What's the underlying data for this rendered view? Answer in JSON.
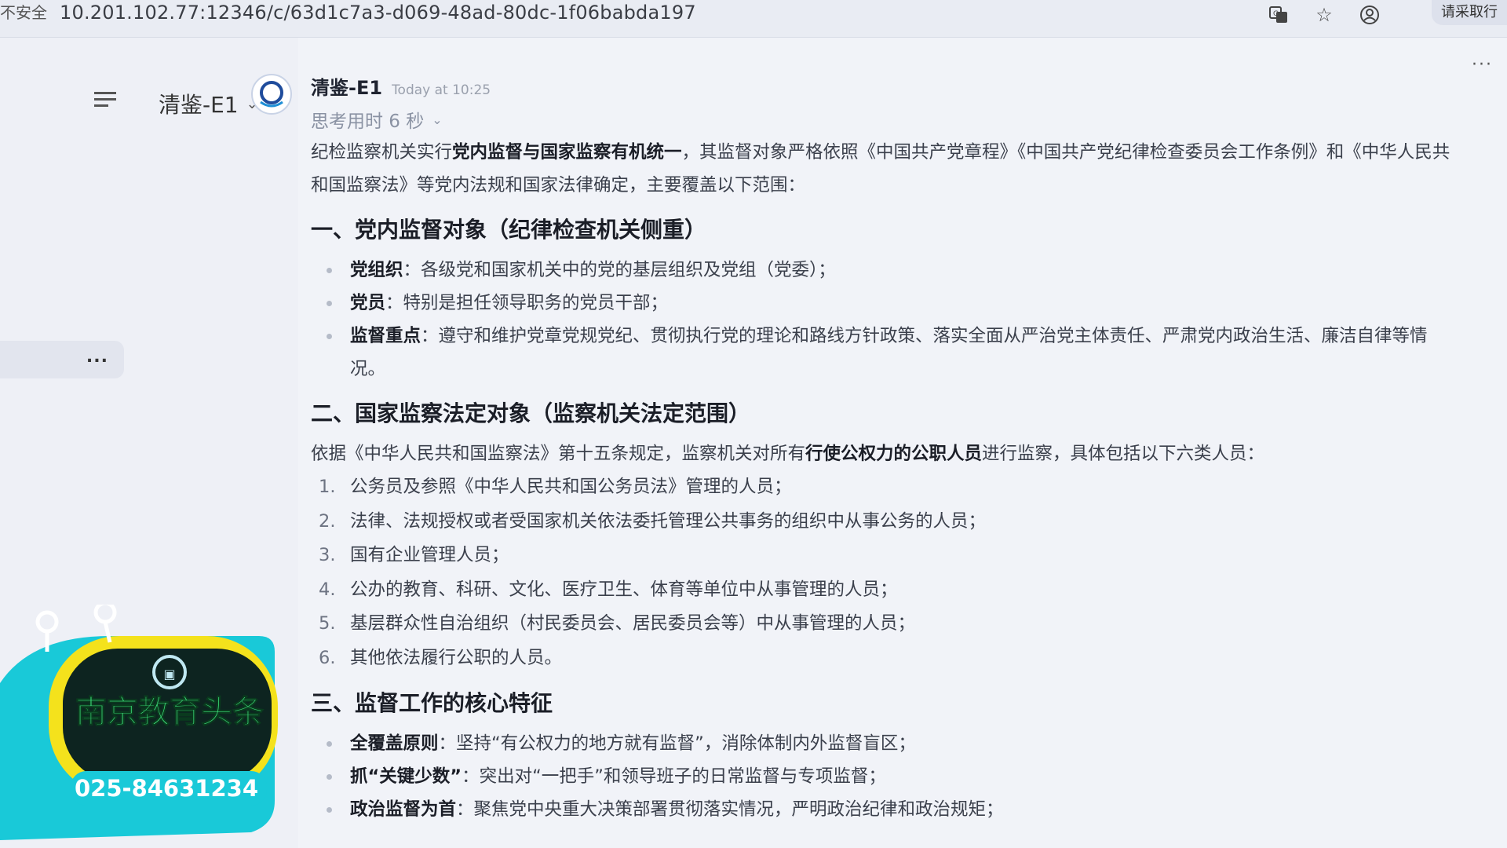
{
  "browser": {
    "insecure_label": "不安全",
    "url": "10.201.102.77:12346/c/63d1c7a3-d069-48ad-80dc-1f06babda197",
    "login_label": "请采取行"
  },
  "sidebar": {
    "model_name": "清鉴-E1",
    "item_menu_label": "..."
  },
  "chat": {
    "more_label": "···",
    "sender": "清鉴-E1",
    "time": "Today at 10:25",
    "thinking": "思考用时 6 秒",
    "intro": {
      "pre": "纪检监察机关实行",
      "bold": "党内监督与国家监察有机统一",
      "post": "，其监督对象严格依照《中国共产党章程》《中国共产党纪律检查委员会工作条例》和《中华人民共和国监察法》等党内法规和国家法律确定，主要覆盖以下范围："
    },
    "section1": {
      "title": "一、党内监督对象（纪律检查机关侧重）",
      "items": [
        {
          "bold": "党组织",
          "text": "：各级党和国家机关中的党的基层组织及党组（党委）；"
        },
        {
          "bold": "党员",
          "text": "：特别是担任领导职务的党员干部；"
        },
        {
          "bold": "监督重点",
          "text": "：遵守和维护党章党规党纪、贯彻执行党的理论和路线方针政策、落实全面从严治党主体责任、严肃党内政治生活、廉洁自律等情况。"
        }
      ]
    },
    "section2": {
      "title": "二、国家监察法定对象（监察机关法定范围）",
      "intro_pre": "依据《中华人民共和国监察法》第十五条规定，监察机关对所有",
      "intro_bold": "行使公权力的公职人员",
      "intro_post": "进行监察，具体包括以下六类人员：",
      "items": [
        {
          "n": "1.",
          "text": "公务员及参照《中华人民共和国公务员法》管理的人员；"
        },
        {
          "n": "2.",
          "text": "法律、法规授权或者受国家机关依法委托管理公共事务的组织中从事公务的人员；"
        },
        {
          "n": "3.",
          "text": "国有企业管理人员；"
        },
        {
          "n": "4.",
          "text": "公办的教育、科研、文化、医疗卫生、体育等单位中从事管理的人员；"
        },
        {
          "n": "5.",
          "text": "基层群众性自治组织（村民委员会、居民委员会等）中从事管理的人员；"
        },
        {
          "n": "6.",
          "text": "其他依法履行公职的人员。"
        }
      ]
    },
    "section3": {
      "title": "三、监督工作的核心特征",
      "items": [
        {
          "bold": "全覆盖原则",
          "text": "：坚持“有公权力的地方就有监督”，消除体制内外监督盲区；"
        },
        {
          "bold": "抓“关键少数”",
          "text": "：突出对“一把手”和领导班子的日常监督与专项监督；"
        },
        {
          "bold": "政治监督为首",
          "text": "：聚焦党中央重大决策部署贯彻落实情况，严明政治纪律和政治规矩；"
        }
      ]
    }
  },
  "overlay": {
    "brand": "南京教育头条",
    "phone": "025-84631234"
  },
  "colors": {
    "badge_cyan": "#19c9d8",
    "badge_yellow": "#f4e21c",
    "badge_text_green": "#3de07a"
  }
}
